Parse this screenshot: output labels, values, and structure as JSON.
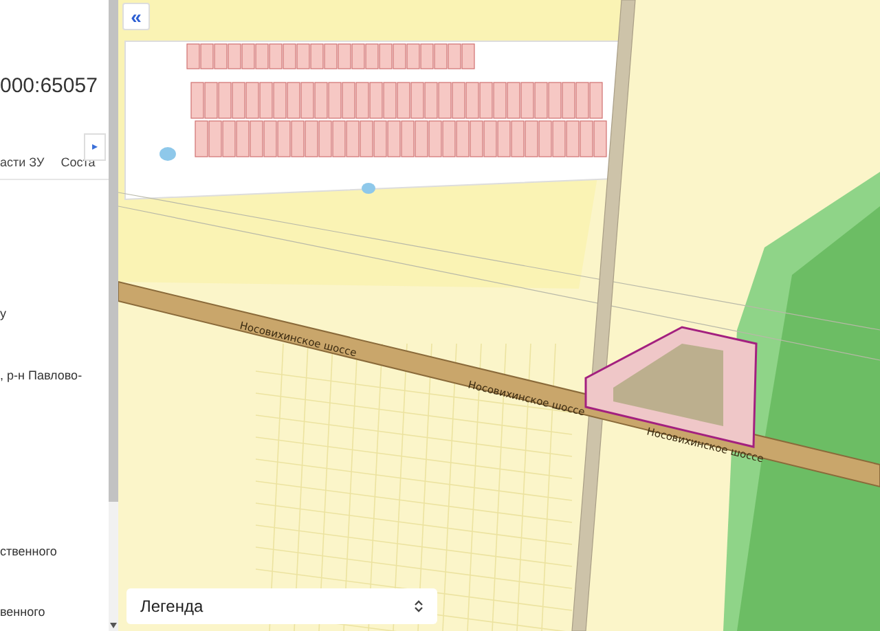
{
  "panel": {
    "cadastral_number": "000:65057",
    "tabs": [
      {
        "label": "асти ЗУ",
        "selected": false
      },
      {
        "label": "Соста",
        "selected": false
      }
    ],
    "tab_scroll_button": "▸",
    "texts": [
      "у",
      ", р-н Павлово-",
      "ственного",
      "венного"
    ]
  },
  "map": {
    "collapse_button": "«",
    "road_labels": [
      "Носовихинское шоссе",
      "Носовихинское шоссе",
      "Носовихинское шоссе"
    ],
    "legend": {
      "label": "Легенда"
    }
  }
}
